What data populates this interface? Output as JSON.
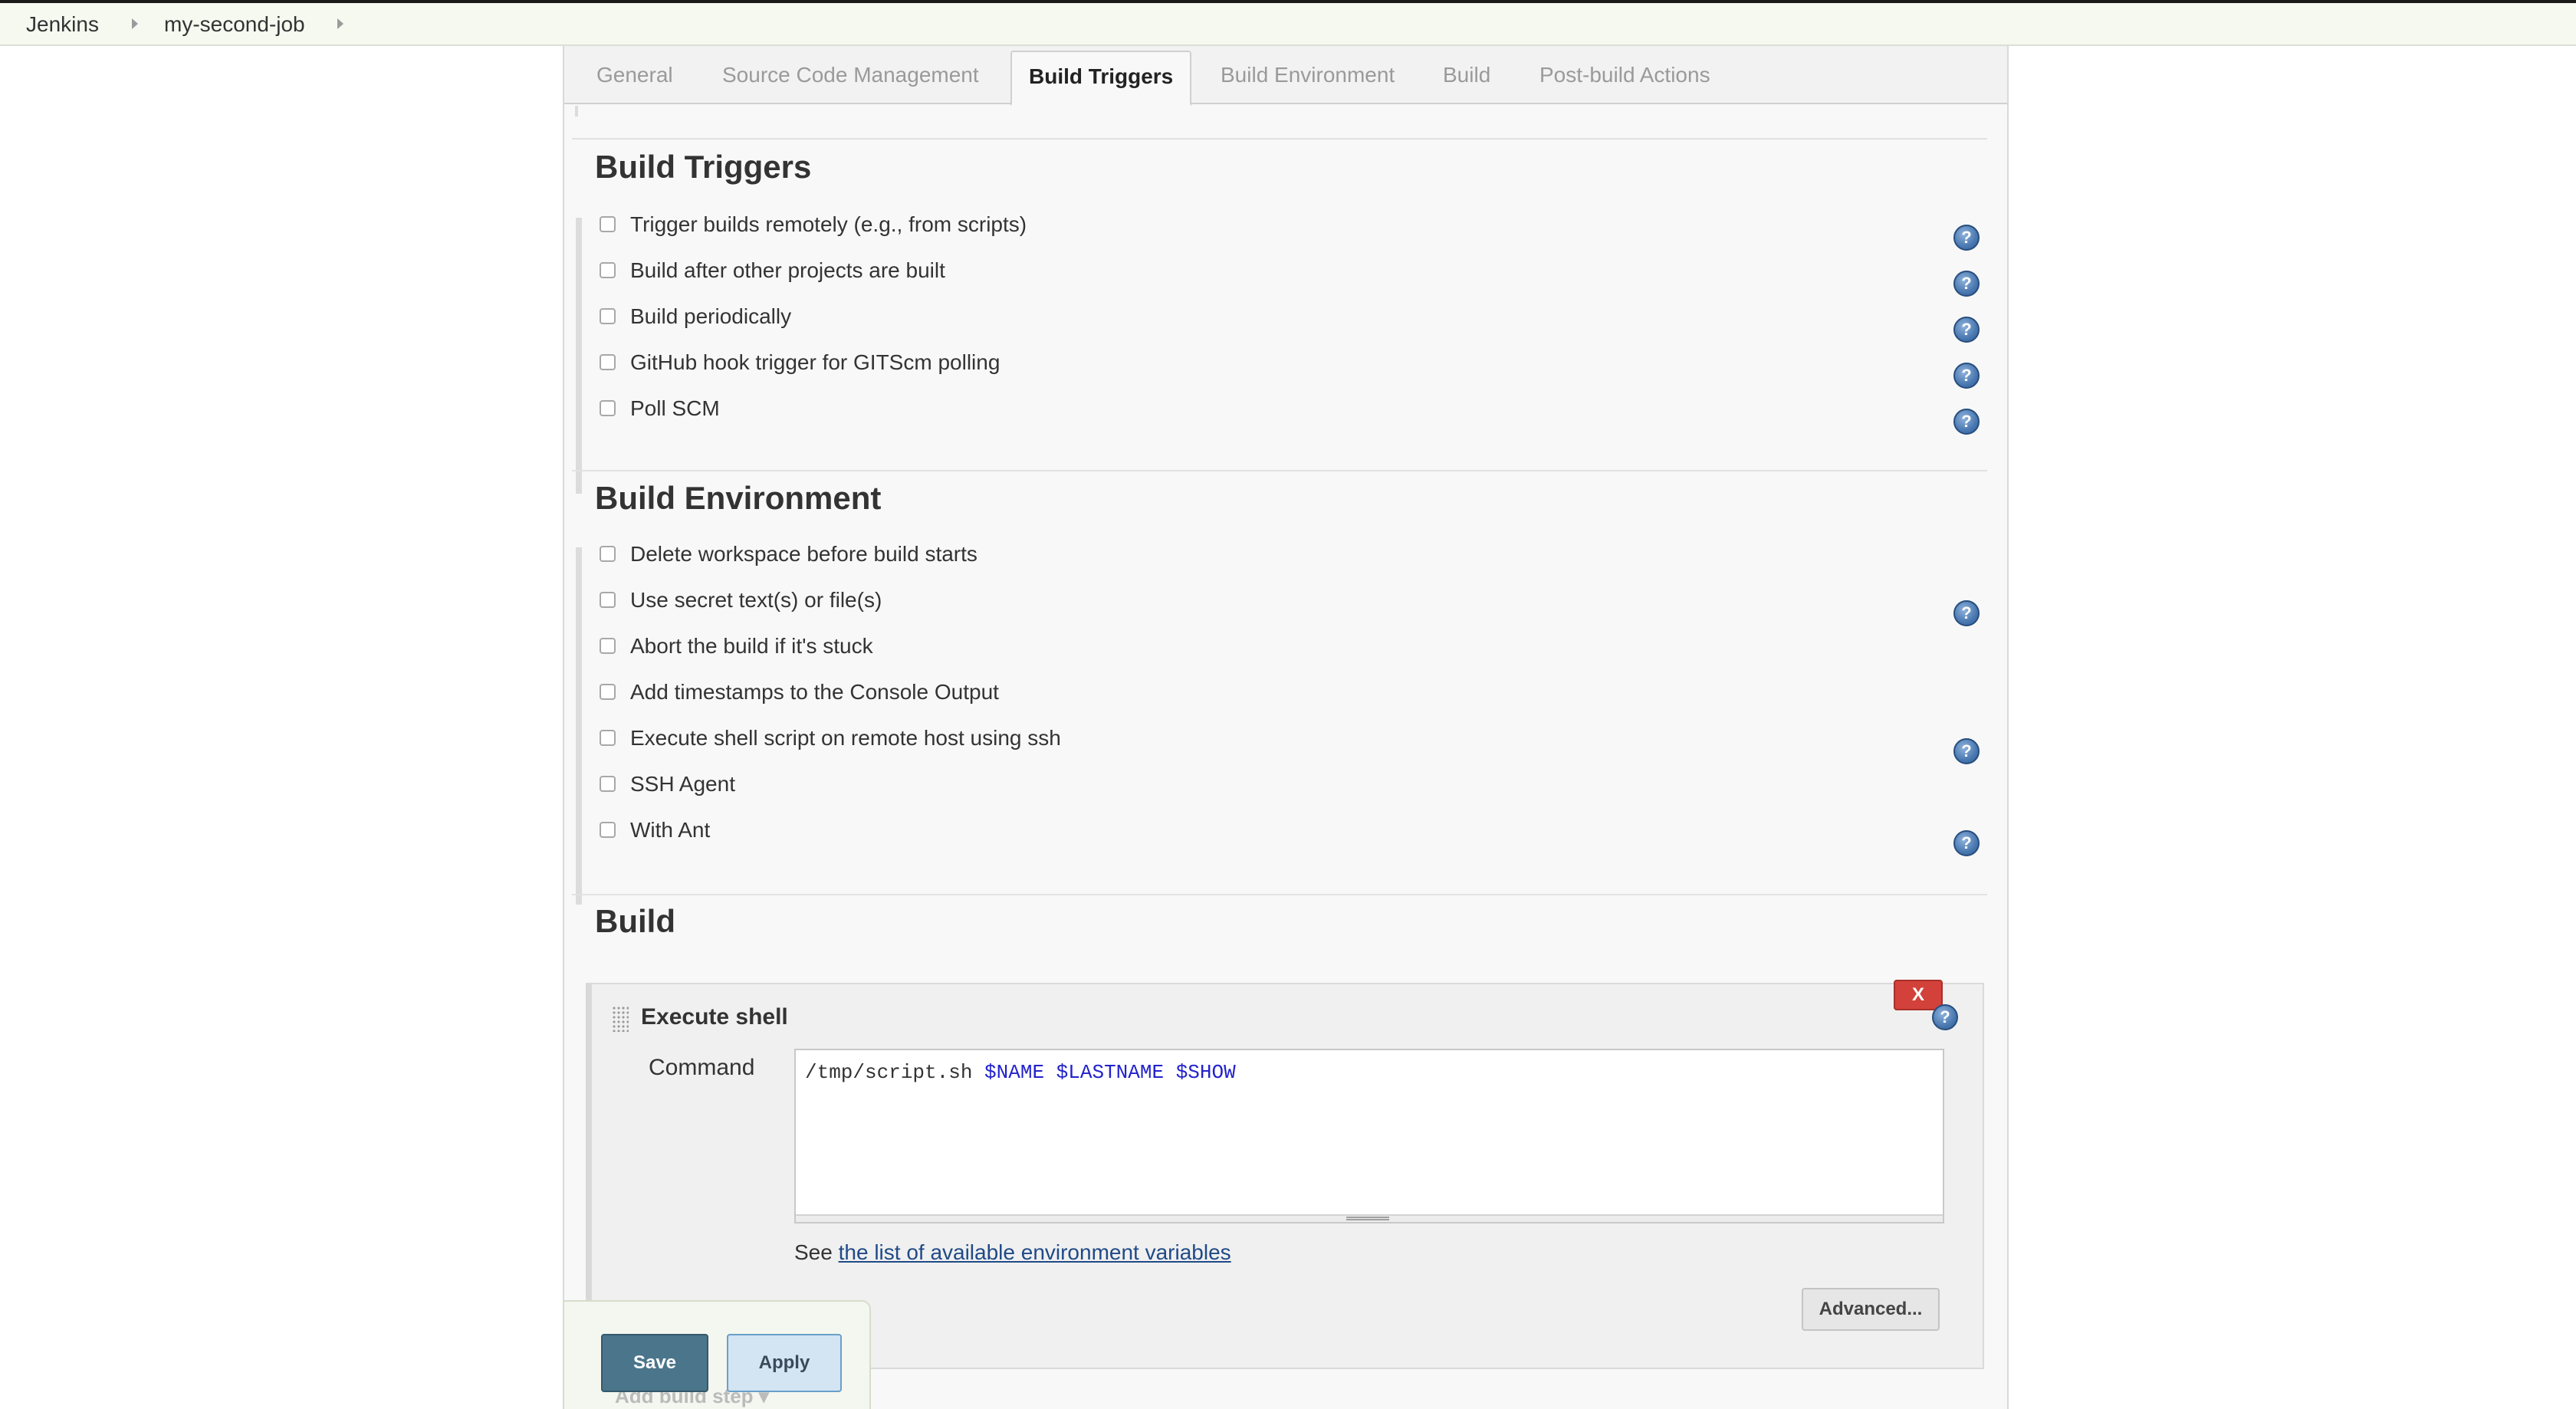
{
  "breadcrumb": {
    "items": [
      "Jenkins",
      "my-second-job"
    ]
  },
  "tabs": [
    {
      "label": "General",
      "active": false
    },
    {
      "label": "Source Code Management",
      "active": false
    },
    {
      "label": "Build Triggers",
      "active": true
    },
    {
      "label": "Build Environment",
      "active": false
    },
    {
      "label": "Build",
      "active": false
    },
    {
      "label": "Post-build Actions",
      "active": false
    }
  ],
  "build_triggers": {
    "title": "Build Triggers",
    "options": [
      {
        "label": "Trigger builds remotely (e.g., from scripts)",
        "checked": false,
        "help": true
      },
      {
        "label": "Build after other projects are built",
        "checked": false,
        "help": true
      },
      {
        "label": "Build periodically",
        "checked": false,
        "help": true
      },
      {
        "label": "GitHub hook trigger for GITScm polling",
        "checked": false,
        "help": true
      },
      {
        "label": "Poll SCM",
        "checked": false,
        "help": true
      }
    ]
  },
  "build_environment": {
    "title": "Build Environment",
    "options": [
      {
        "label": "Delete workspace before build starts",
        "checked": false,
        "help": false
      },
      {
        "label": "Use secret text(s) or file(s)",
        "checked": false,
        "help": true
      },
      {
        "label": "Abort the build if it's stuck",
        "checked": false,
        "help": false
      },
      {
        "label": "Add timestamps to the Console Output",
        "checked": false,
        "help": false
      },
      {
        "label": "Execute shell script on remote host using ssh",
        "checked": false,
        "help": true
      },
      {
        "label": "SSH Agent",
        "checked": false,
        "help": false
      },
      {
        "label": "With Ant",
        "checked": false,
        "help": true
      }
    ]
  },
  "build": {
    "title": "Build",
    "step": {
      "title": "Execute shell",
      "delete_label": "X",
      "command_label": "Command",
      "command": {
        "plain": "/tmp/script.sh ",
        "vars": "$NAME $LASTNAME $SHOW"
      },
      "see_prefix": "See ",
      "see_link": "the list of available environment variables",
      "advanced_label": "Advanced..."
    },
    "add_step_label": "Add build step"
  },
  "actions": {
    "save_label": "Save",
    "apply_label": "Apply"
  },
  "icons": {
    "help": "help-icon",
    "breadcrumb_separator": "chevron-right-icon",
    "drag_handle": "drag-handle-icon",
    "dropdown": "chevron-down-icon"
  },
  "colors": {
    "save_bg": "#4b758b",
    "apply_bg": "#d3e4f2",
    "delete_bg": "#d2413a",
    "link": "#204a87",
    "help_icon": "#4a78b0",
    "command_vars": "#2222cc"
  }
}
